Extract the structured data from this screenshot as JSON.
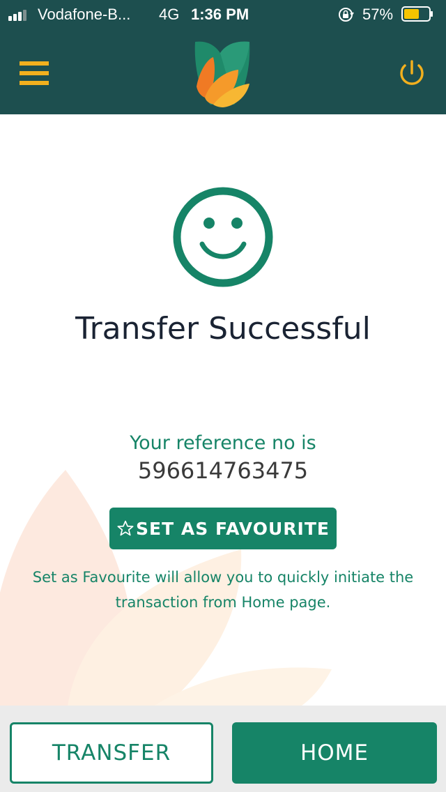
{
  "status_bar": {
    "carrier": "Vodafone-B...",
    "network": "4G",
    "time": "1:36 PM",
    "battery_percent": "57%",
    "icons": [
      "signal-icon",
      "orientation-lock-icon",
      "battery-icon"
    ]
  },
  "header": {
    "icons": [
      "hamburger-menu-icon",
      "app-logo",
      "power-icon"
    ]
  },
  "main": {
    "status_icon": "smiley-icon",
    "title": "Transfer Successful",
    "reference_label": "Your reference no is",
    "reference_number": "596614763475",
    "favourite_button": {
      "icon": "star-outline-icon",
      "label": "SET AS FAVOURITE"
    },
    "favourite_note": "Set as Favourite will allow you to quickly initiate the transaction from Home page."
  },
  "footer": {
    "transfer_label": "TRANSFER",
    "home_label": "HOME"
  },
  "colors": {
    "header_bg": "#1d4f4f",
    "accent_green": "#168467",
    "accent_yellow": "#f2b01e",
    "title_text": "#1a2333"
  }
}
